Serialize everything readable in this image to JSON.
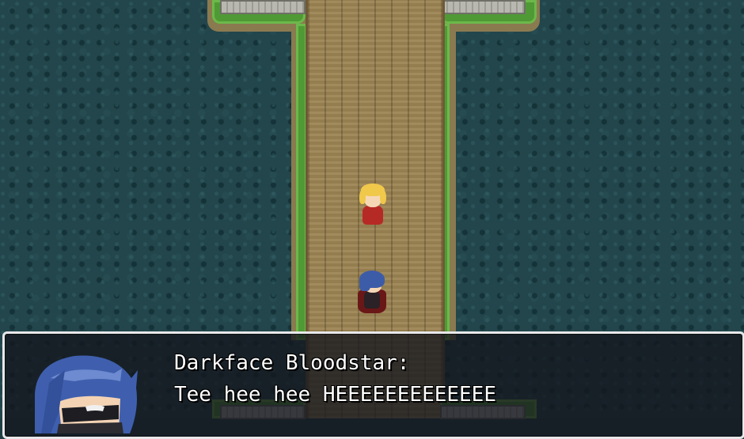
{
  "dialog": {
    "speaker": "Darkface Bloodstar:",
    "message": "Tee hee hee HEEEEEEEEEEEEE"
  },
  "scene": {
    "water_color": "#22464c",
    "grass_color": "#4f9a35",
    "bridge_color": "#9c8453"
  },
  "characters": [
    {
      "name": "blonde-red-armored-character"
    },
    {
      "name": "blue-haired-caped-character"
    }
  ]
}
